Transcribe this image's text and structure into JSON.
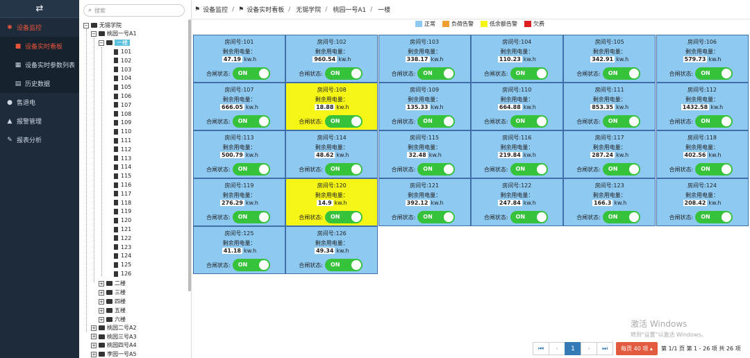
{
  "sidebar": {
    "toggle_icon": "swap-icon",
    "items": [
      {
        "label": "设备监控",
        "icon": "gear-icon"
      },
      {
        "label": "设备实时看板",
        "icon": "dashboard-icon"
      },
      {
        "label": "设备实时参数列表",
        "icon": "grid-icon"
      },
      {
        "label": "历史数据",
        "icon": "book-icon"
      },
      {
        "label": "售退电",
        "icon": "bulb-icon"
      },
      {
        "label": "报警管理",
        "icon": "bell-icon"
      },
      {
        "label": "报表分析",
        "icon": "wrench-icon"
      }
    ]
  },
  "tree": {
    "search_placeholder": "搜索",
    "root": "无锡学院",
    "building": "桃园一号A1",
    "floor_selected": "一楼",
    "rooms": [
      "101",
      "102",
      "103",
      "104",
      "105",
      "106",
      "107",
      "108",
      "109",
      "110",
      "111",
      "112",
      "113",
      "114",
      "115",
      "116",
      "117",
      "118",
      "119",
      "120",
      "121",
      "122",
      "123",
      "124",
      "125",
      "126"
    ],
    "other_floors": [
      "二楼",
      "三楼",
      "四楼",
      "五楼",
      "六楼"
    ],
    "other_buildings": [
      "桃园二号A2",
      "桃园三号A3",
      "桃园四号A4",
      "李园一号A5"
    ]
  },
  "breadcrumb": [
    "设备监控",
    "设备实时看板",
    "无锡学院",
    "桃园一号A1",
    "一楼"
  ],
  "legend": [
    {
      "label": "正常",
      "color": "#8ec9f2"
    },
    {
      "label": "负荷告警",
      "color": "#f0a030"
    },
    {
      "label": "低余额告警",
      "color": "#f5f516"
    },
    {
      "label": "欠费",
      "color": "#e02020"
    }
  ],
  "cell_text": {
    "room_prefix": "房间号:",
    "remaining_label": "剩余用电量：",
    "unit": "kw.h",
    "switch_label": "合闸状态:",
    "switch_on": "ON"
  },
  "rooms": [
    {
      "room": "101",
      "value": "47.19",
      "status": "normal"
    },
    {
      "room": "102",
      "value": "960.54",
      "status": "normal"
    },
    {
      "room": "103",
      "value": "338.17",
      "status": "normal"
    },
    {
      "room": "104",
      "value": "110.23",
      "status": "normal"
    },
    {
      "room": "105",
      "value": "342.91",
      "status": "normal"
    },
    {
      "room": "106",
      "value": "579.73",
      "status": "normal"
    },
    {
      "room": "107",
      "value": "666.05",
      "status": "normal"
    },
    {
      "room": "108",
      "value": "18.88",
      "status": "low"
    },
    {
      "room": "109",
      "value": "135.33",
      "status": "normal"
    },
    {
      "room": "110",
      "value": "664.88",
      "status": "normal"
    },
    {
      "room": "111",
      "value": "853.35",
      "status": "normal"
    },
    {
      "room": "112",
      "value": "1432.58",
      "status": "normal"
    },
    {
      "room": "113",
      "value": "500.79",
      "status": "normal"
    },
    {
      "room": "114",
      "value": "48.62",
      "status": "normal"
    },
    {
      "room": "115",
      "value": "32.48",
      "status": "normal"
    },
    {
      "room": "116",
      "value": "219.84",
      "status": "normal"
    },
    {
      "room": "117",
      "value": "287.24",
      "status": "normal"
    },
    {
      "room": "118",
      "value": "402.56",
      "status": "normal"
    },
    {
      "room": "119",
      "value": "276.29",
      "status": "normal"
    },
    {
      "room": "120",
      "value": "14.9",
      "status": "low"
    },
    {
      "room": "121",
      "value": "392.12",
      "status": "normal"
    },
    {
      "room": "122",
      "value": "247.84",
      "status": "normal"
    },
    {
      "room": "123",
      "value": "166.3",
      "status": "normal"
    },
    {
      "room": "124",
      "value": "208.42",
      "status": "normal"
    },
    {
      "room": "125",
      "value": "41.18",
      "status": "normal"
    },
    {
      "room": "126",
      "value": "49.34",
      "status": "normal"
    }
  ],
  "pager": {
    "first": "⏮",
    "prev": "‹",
    "current": "1",
    "next": "›",
    "last": "⏭",
    "per_page": "每页 40 项 ▴",
    "info": "第 1/1 页  第 1 - 26 项  共 26 项"
  },
  "watermark": {
    "line1": "激活 Windows",
    "line2": "转到\"设置\"以激活 Windows。"
  }
}
